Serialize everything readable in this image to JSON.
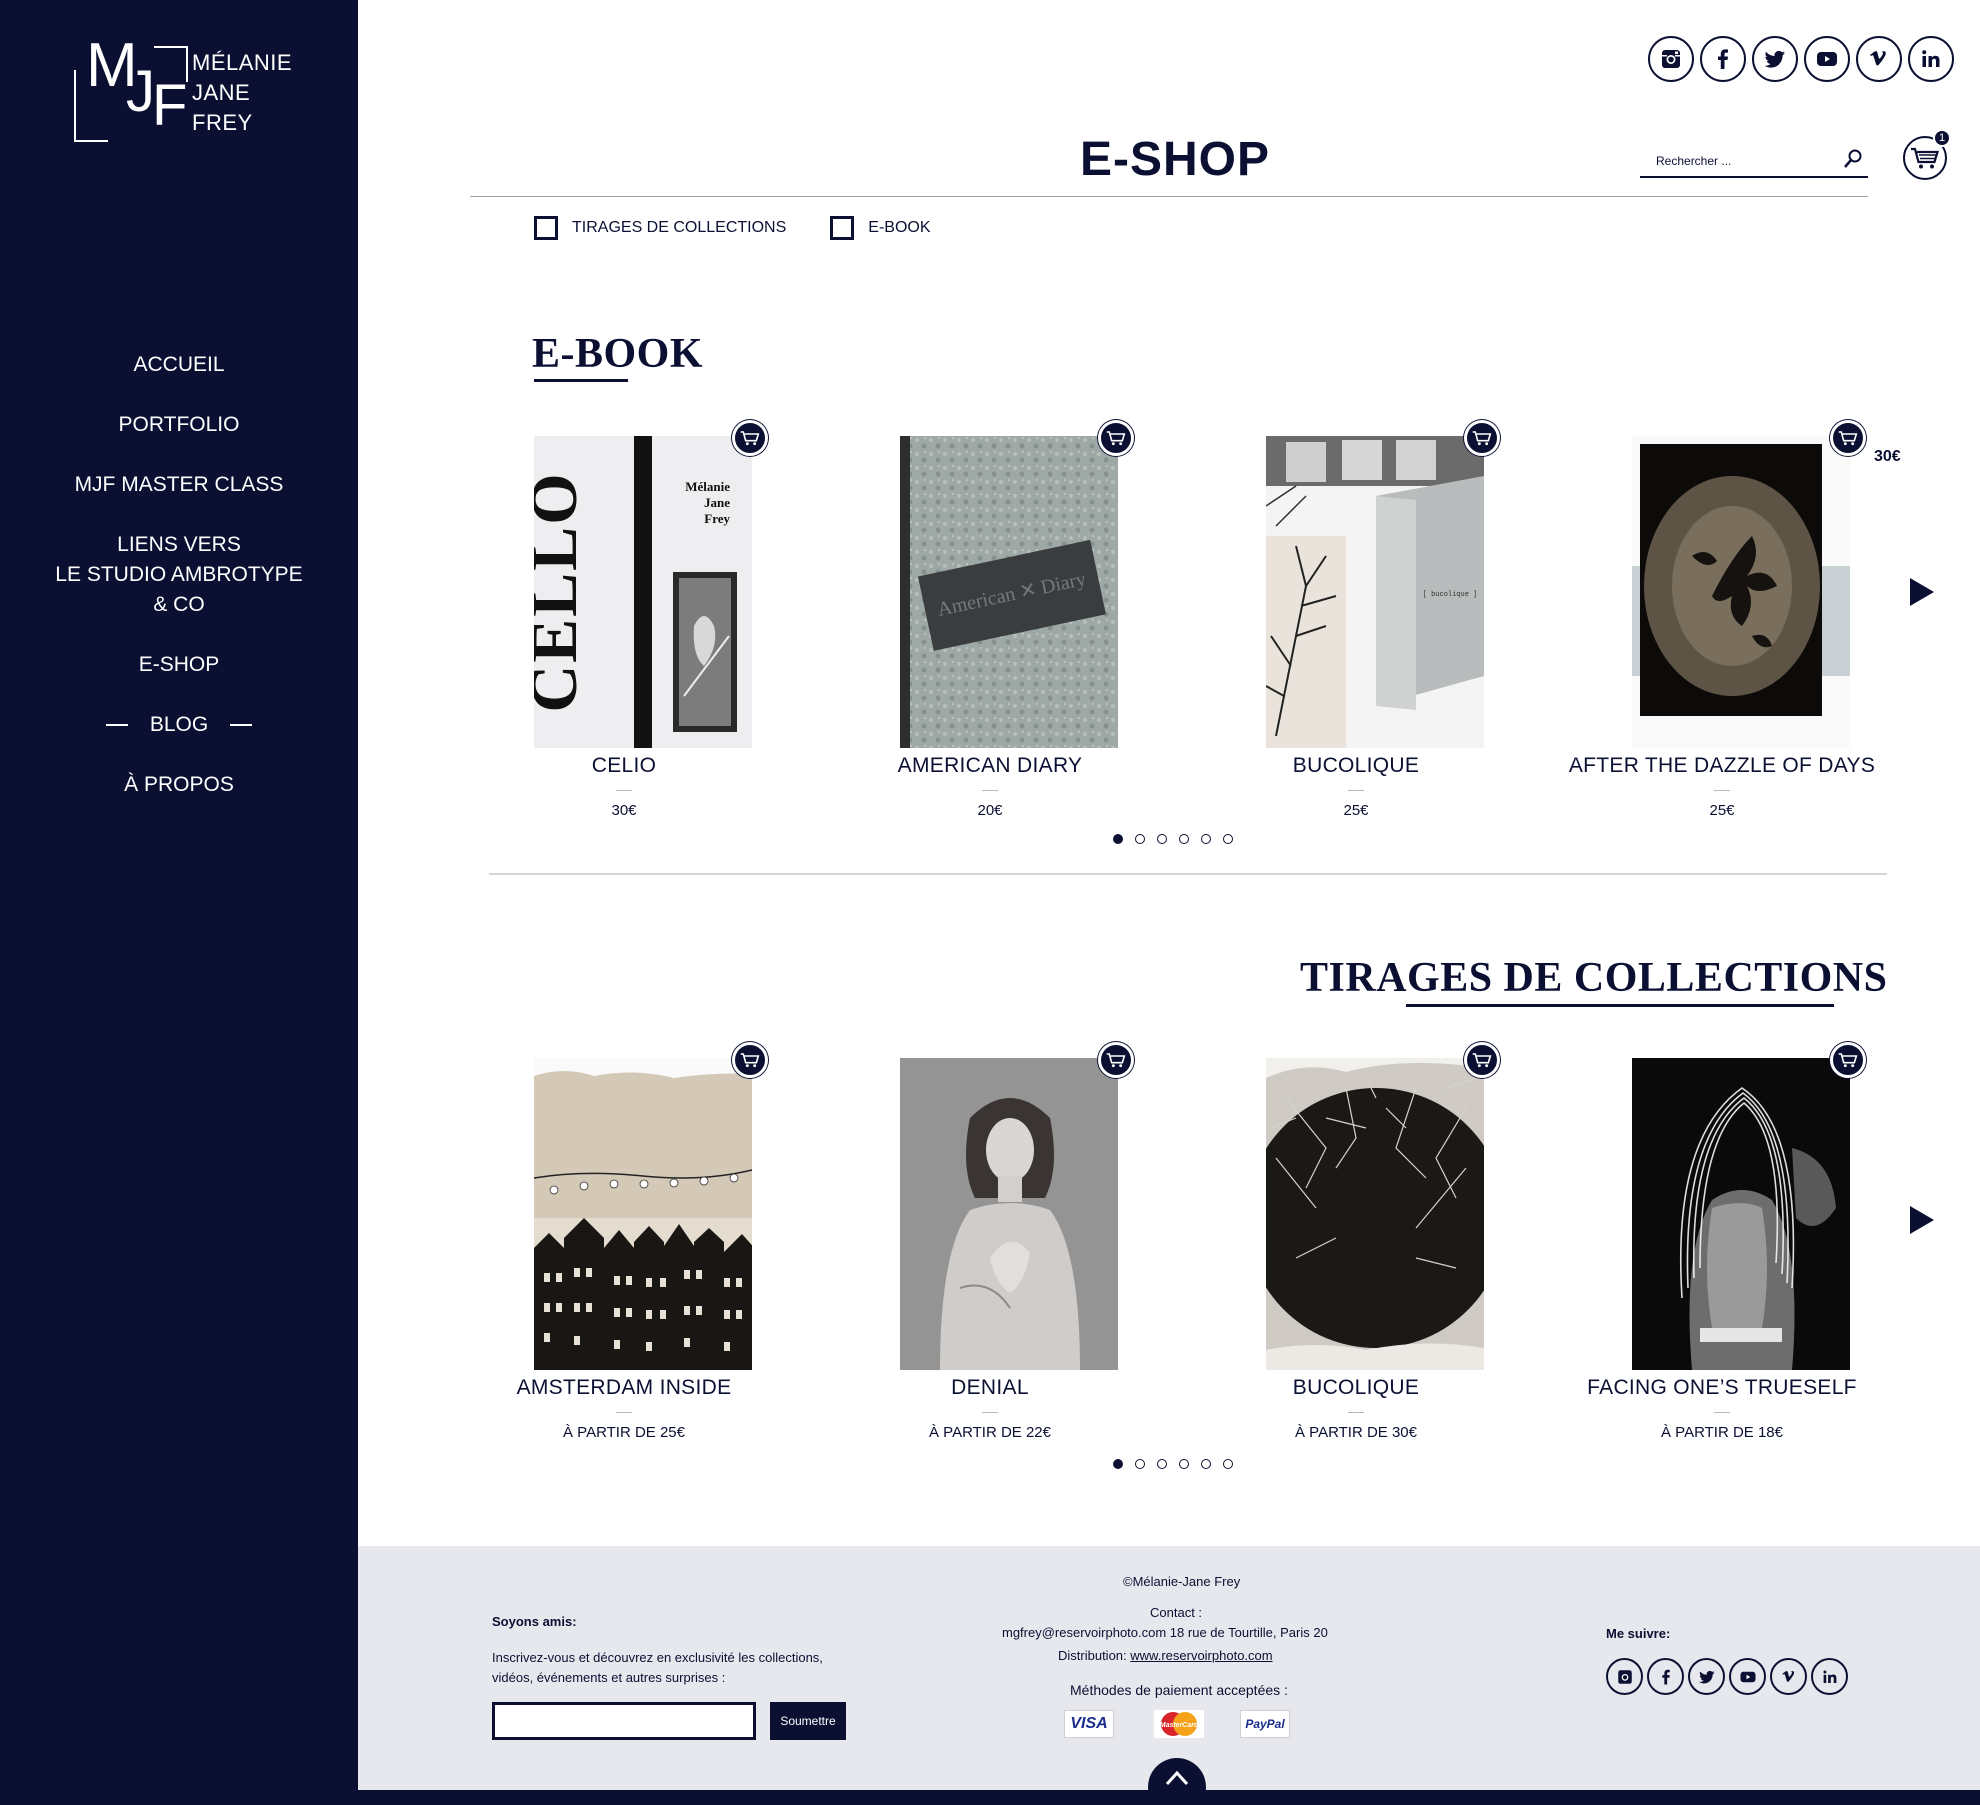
{
  "brand": {
    "monogram_m": "M",
    "monogram_j": "J",
    "monogram_f": "F",
    "name_line1": "MÉLANIE",
    "name_line2": "JANE",
    "name_line3": "FREY"
  },
  "nav": {
    "items": [
      {
        "label": "ACCUEIL"
      },
      {
        "label": "PORTFOLIO"
      },
      {
        "label": "MJF MASTER CLASS"
      },
      {
        "label_line1": "LIENS VERS",
        "label_line2": "LE STUDIO AMBROTYPE",
        "label_line3": "& CO"
      },
      {
        "label": "E-SHOP"
      },
      {
        "label": "BLOG"
      },
      {
        "label": "À PROPOS"
      }
    ]
  },
  "social": [
    "instagram-icon",
    "facebook-icon",
    "twitter-icon",
    "youtube-icon",
    "vimeo-icon",
    "linkedin-icon"
  ],
  "header": {
    "title": "E-SHOP",
    "search_placeholder": "Rechercher ...",
    "cart_count": "1"
  },
  "filters": [
    {
      "label": "TIRAGES DE COLLECTIONS"
    },
    {
      "label": "E-BOOK"
    }
  ],
  "ebook": {
    "title": "E-BOOK",
    "products": [
      {
        "title": "CELIO",
        "price": "30€"
      },
      {
        "title": "AMERICAN DIARY",
        "price": "20€"
      },
      {
        "title": "BUCOLIQUE",
        "price": "25€"
      },
      {
        "title": "AFTER THE DAZZLE OF DAYS",
        "price": "25€",
        "extra_price": "30€"
      }
    ],
    "cover_text": {
      "celio_title": "CELLO",
      "celio_author1": "Mélanie",
      "celio_author2": "Jane",
      "celio_author3": "Frey",
      "diary_label": "American ✕ Diary",
      "bucolique_label": "[ bucolique ]"
    },
    "dots": 6,
    "active_dot": 0
  },
  "collections": {
    "title": "TIRAGES DE COLLECTIONS",
    "products": [
      {
        "title": "AMSTERDAM INSIDE",
        "price": "À PARTIR DE 25€"
      },
      {
        "title": "DENIAL",
        "price": "À PARTIR DE 22€"
      },
      {
        "title": "BUCOLIQUE",
        "price": "À PARTIR DE 30€"
      },
      {
        "title": "FACING ONE’S TRUESELF",
        "price": "À PARTIR DE 18€"
      }
    ],
    "dots": 6,
    "active_dot": 0
  },
  "footer": {
    "copyright": "©Mélanie-Jane Frey",
    "contact_label": "Contact :",
    "contact_line": "mgfrey@reservoirphoto.com 18 rue de Tourtille, Paris 20",
    "distribution_label": "Distribution:",
    "distribution_link": "www.reservoirphoto.com",
    "payment_label": "Méthodes de paiement acceptées :",
    "payments": {
      "visa": "VISA",
      "mastercard": "MasterCard",
      "paypal": "PayPal"
    },
    "newsletter_title": "Soyons amis:",
    "newsletter_text1": "Inscrivez-vous et découvrez en exclusivité les collections,",
    "newsletter_text2": "vidéos, événements et autres surprises :",
    "submit_label": "Soumettre",
    "follow_label": "Me suivre:"
  },
  "colors": {
    "navy": "#0b1033",
    "footer_bg": "#e7e8ed"
  }
}
